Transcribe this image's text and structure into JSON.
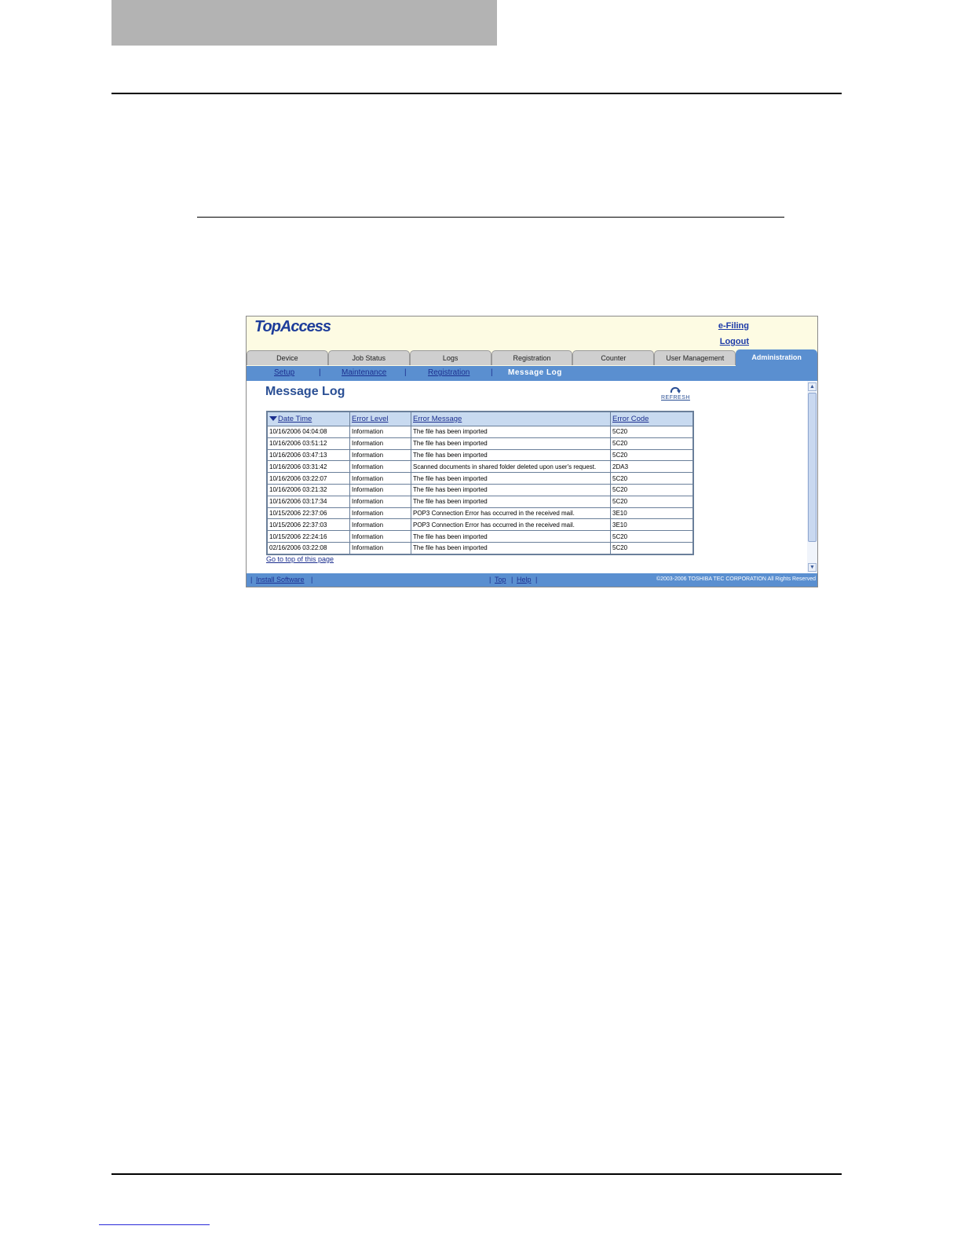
{
  "app": {
    "logo": "TopAccess",
    "efiling": "e-Filing",
    "logout": "Logout"
  },
  "tabs": [
    "Device",
    "Job Status",
    "Logs",
    "Registration",
    "Counter",
    "User Management",
    "Administration"
  ],
  "active_tab": "Administration",
  "subnav": {
    "setup": "Setup",
    "maintenance": "Maintenance",
    "registration": "Registration",
    "current": "Message Log",
    "separator": "|"
  },
  "page": {
    "title": "Message Log",
    "refresh_label": "REFRESH"
  },
  "table": {
    "headers": {
      "date_time": "Date Time",
      "error_level": "Error Level",
      "error_message": "Error Message",
      "error_code": "Error Code"
    },
    "rows": [
      [
        "10/16/2006 04:04:08",
        "Information",
        "The file has been imported",
        "5C20"
      ],
      [
        "10/16/2006 03:51:12",
        "Information",
        "The file has been imported",
        "5C20"
      ],
      [
        "10/16/2006 03:47:13",
        "Information",
        "The file has been imported",
        "5C20"
      ],
      [
        "10/16/2006 03:31:42",
        "Information",
        "Scanned documents in shared folder deleted upon user's request.",
        "2DA3"
      ],
      [
        "10/16/2006 03:22:07",
        "Information",
        "The file has been imported",
        "5C20"
      ],
      [
        "10/16/2006 03:21:32",
        "Information",
        "The file has been imported",
        "5C20"
      ],
      [
        "10/16/2006 03:17:34",
        "Information",
        "The file has been imported",
        "5C20"
      ],
      [
        "10/15/2006 22:37:06",
        "Information",
        "POP3 Connection Error has occurred in the received mail.",
        "3E10"
      ],
      [
        "10/15/2006 22:37:03",
        "Information",
        "POP3 Connection Error has occurred in the received mail.",
        "3E10"
      ],
      [
        "10/15/2006 22:24:16",
        "Information",
        "The file has been imported",
        "5C20"
      ],
      [
        "02/16/2006 03:22:08",
        "Information",
        "The file has been imported",
        "5C20"
      ]
    ]
  },
  "go_top": "Go to top of this page",
  "footer": {
    "install_software": "Install Software",
    "top": "Top",
    "help": "Help",
    "separator": "|",
    "copyright": "©2003-2006 TOSHIBA TEC CORPORATION All Rights Reserved"
  }
}
